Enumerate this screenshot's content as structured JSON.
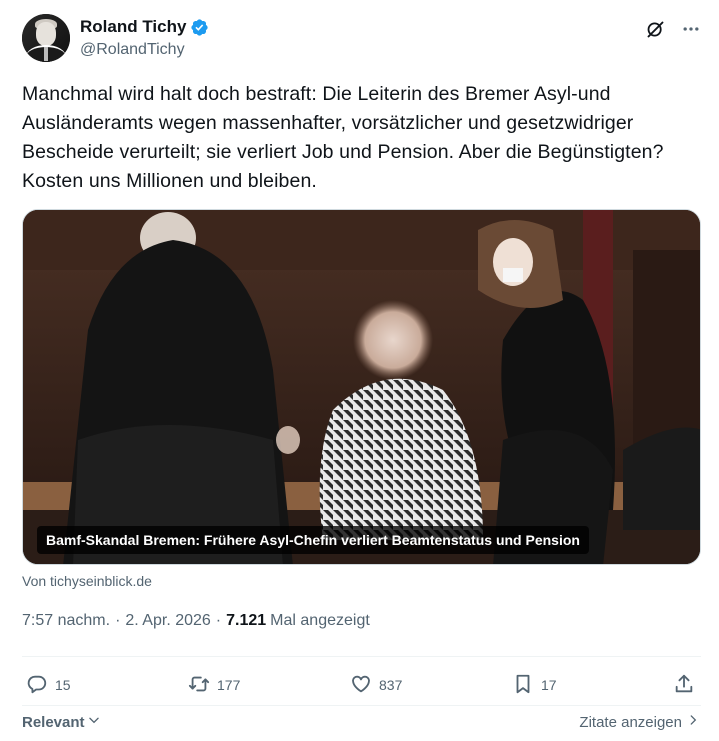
{
  "author": {
    "display_name": "Roland Tichy",
    "handle": "@RolandTichy",
    "verified": true
  },
  "tweet": {
    "text": "Manchmal wird halt doch bestraft: Die Leiterin des Bremer Asyl-und Ausländeramts wegen massenhafter, vorsätzlicher und gesetzwidriger Bescheide verurteilt; sie verliert Job und Pension. Aber die Begünstigten? Kosten uns Millionen und bleiben."
  },
  "media": {
    "caption": "Bamf-Skandal Bremen: Frühere Asyl-Chefin verliert Beamtenstatus und Pension"
  },
  "link_source": "Von tichyseinblick.de",
  "meta": {
    "time": "7:57 nachm.",
    "separator": "·",
    "date": "2. Apr. 2026",
    "views_count": "7.121",
    "views_label": "Mal angezeigt"
  },
  "actions": {
    "replies": "15",
    "reposts": "177",
    "likes": "837",
    "bookmarks": "17"
  },
  "footer": {
    "sort_label": "Relevant",
    "quotes_label": "Zitate anzeigen"
  },
  "colors": {
    "text": "#0f1419",
    "secondary": "#536471",
    "verified_blue": "#1d9bf0",
    "divider": "#eff3f4"
  },
  "icons": {
    "verified": "verified-badge-icon",
    "grok": "grok-icon",
    "more": "more-icon",
    "reply": "reply-icon",
    "repost": "repost-icon",
    "like": "heart-icon",
    "bookmark": "bookmark-icon",
    "share": "share-icon"
  }
}
